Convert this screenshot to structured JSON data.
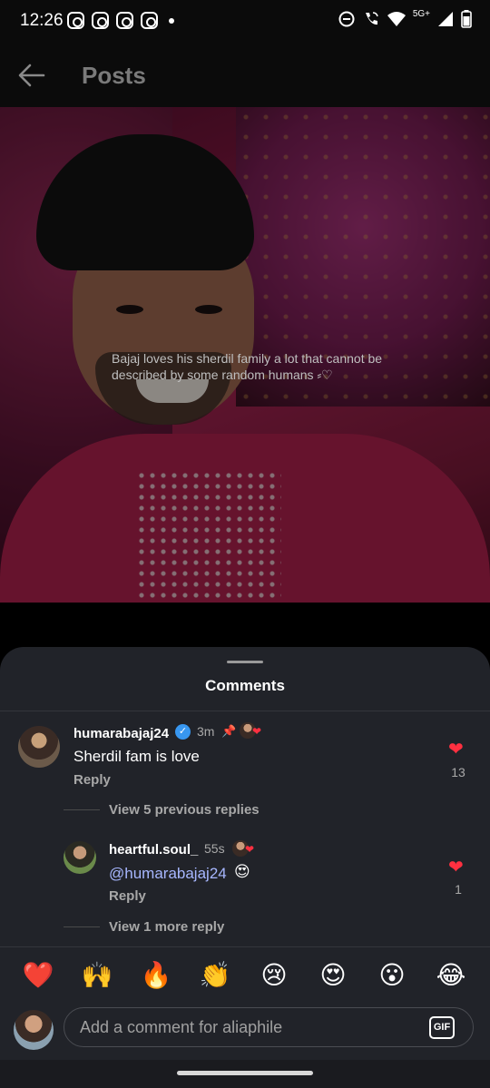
{
  "status_bar": {
    "time": "12:26",
    "network": "5G+",
    "left_icons": [
      "instagram-icon",
      "instagram-icon",
      "instagram-icon",
      "instagram-icon",
      "dot-icon"
    ],
    "right_icons": [
      "dnd-icon",
      "wifi-call-icon",
      "wifi-icon",
      "signal-icon",
      "battery-icon"
    ]
  },
  "header": {
    "title": "Posts",
    "back_icon": "arrow-left-icon"
  },
  "post": {
    "overlay_text": "Bajaj loves his sherdil family a lot that cannot be described by some random humans ⸗♡"
  },
  "comments_sheet": {
    "title": "Comments",
    "comments": [
      {
        "username": "humarabajaj24",
        "verified": true,
        "time": "3m",
        "pinned": true,
        "text": "Sherdil fam is love",
        "reply_label": "Reply",
        "likes": "13",
        "liked": true,
        "view_replies": "View 5 previous replies"
      }
    ],
    "replies": [
      {
        "username": "heartful.soul_",
        "time": "55s",
        "mention": "@humarabajaj24",
        "emoji": "😍",
        "reply_label": "Reply",
        "likes": "1",
        "liked": true,
        "view_replies": "View 1 more reply"
      }
    ],
    "reactions": [
      "❤️",
      "🙌",
      "🔥",
      "👏",
      "😢",
      "😍",
      "😮",
      "😂"
    ],
    "input": {
      "placeholder": "Add a comment for aliaphile",
      "gif_label": "GIF"
    }
  },
  "colors": {
    "sheet_bg": "#212329",
    "like": "#ff3040",
    "verified": "#3897f0",
    "mention": "#a7b7ff"
  }
}
